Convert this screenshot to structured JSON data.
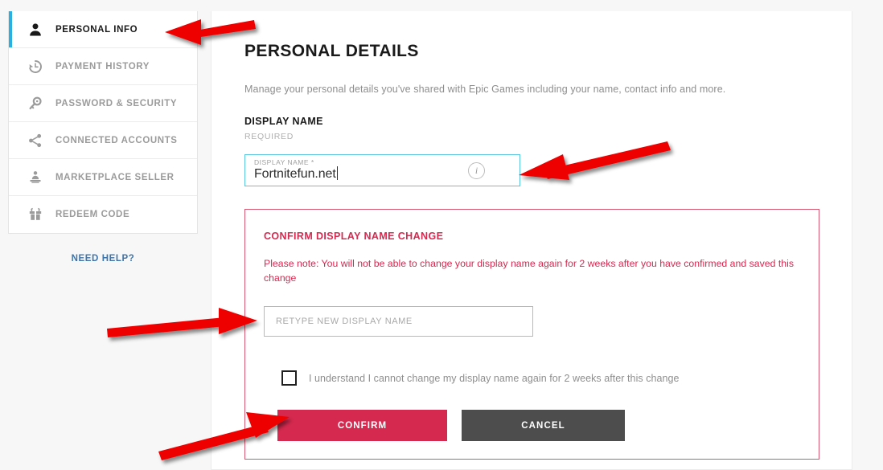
{
  "sidebar": {
    "items": [
      {
        "label": "PERSONAL INFO",
        "icon": "person-icon",
        "active": true
      },
      {
        "label": "PAYMENT HISTORY",
        "icon": "history-icon",
        "active": false
      },
      {
        "label": "PASSWORD & SECURITY",
        "icon": "key-icon",
        "active": false
      },
      {
        "label": "CONNECTED ACCOUNTS",
        "icon": "share-icon",
        "active": false
      },
      {
        "label": "MARKETPLACE SELLER",
        "icon": "seller-icon",
        "active": false
      },
      {
        "label": "REDEEM CODE",
        "icon": "gift-icon",
        "active": false
      }
    ],
    "need_help_label": "NEED HELP?"
  },
  "main": {
    "page_title": "PERSONAL DETAILS",
    "intro_text": "Manage your personal details you've shared with Epic Games including your name, contact info and more.",
    "section_title": "DISPLAY NAME",
    "section_required": "REQUIRED",
    "display_field": {
      "label": "DISPLAY NAME *",
      "value": "Fortnitefun.net",
      "info_icon": "i"
    },
    "confirm_box": {
      "heading": "CONFIRM DISPLAY NAME CHANGE",
      "note": "Please note: You will not be able to change your display name again for 2 weeks after you have confirmed and saved this change",
      "retype_placeholder": "RETYPE NEW DISPLAY NAME",
      "retype_value": "",
      "acknowledge_label": "I understand I cannot change my display name again for 2 weeks after this change",
      "acknowledge_checked": false,
      "confirm_label": "CONFIRM",
      "cancel_label": "CANCEL"
    }
  },
  "colors": {
    "accent_blue": "#2ab0e0",
    "brand_red": "#d6294f",
    "field_border_teal": "#5bc6df",
    "cancel_gray": "#4d4d4d",
    "annotation_red": "#ee0000",
    "link_blue": "#3d74ab"
  },
  "annotations": {
    "arrows": [
      {
        "name": "arrow-to-personal-info",
        "direction": "left"
      },
      {
        "name": "arrow-to-display-name-field",
        "direction": "down-left"
      },
      {
        "name": "arrow-to-retype-field",
        "direction": "right"
      },
      {
        "name": "arrow-to-confirm-button",
        "direction": "up-right"
      }
    ]
  }
}
